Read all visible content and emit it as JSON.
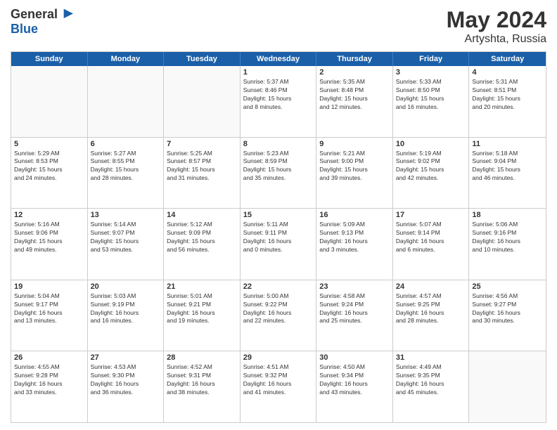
{
  "header": {
    "logo": {
      "general": "General",
      "blue": "Blue",
      "tagline": ""
    },
    "title": "May 2024",
    "subtitle": "Artyshta, Russia"
  },
  "days_of_week": [
    "Sunday",
    "Monday",
    "Tuesday",
    "Wednesday",
    "Thursday",
    "Friday",
    "Saturday"
  ],
  "weeks": [
    [
      {
        "day": "",
        "info": ""
      },
      {
        "day": "",
        "info": ""
      },
      {
        "day": "",
        "info": ""
      },
      {
        "day": "1",
        "info": "Sunrise: 5:37 AM\nSunset: 8:46 PM\nDaylight: 15 hours\nand 8 minutes."
      },
      {
        "day": "2",
        "info": "Sunrise: 5:35 AM\nSunset: 8:48 PM\nDaylight: 15 hours\nand 12 minutes."
      },
      {
        "day": "3",
        "info": "Sunrise: 5:33 AM\nSunset: 8:50 PM\nDaylight: 15 hours\nand 16 minutes."
      },
      {
        "day": "4",
        "info": "Sunrise: 5:31 AM\nSunset: 8:51 PM\nDaylight: 15 hours\nand 20 minutes."
      }
    ],
    [
      {
        "day": "5",
        "info": "Sunrise: 5:29 AM\nSunset: 8:53 PM\nDaylight: 15 hours\nand 24 minutes."
      },
      {
        "day": "6",
        "info": "Sunrise: 5:27 AM\nSunset: 8:55 PM\nDaylight: 15 hours\nand 28 minutes."
      },
      {
        "day": "7",
        "info": "Sunrise: 5:25 AM\nSunset: 8:57 PM\nDaylight: 15 hours\nand 31 minutes."
      },
      {
        "day": "8",
        "info": "Sunrise: 5:23 AM\nSunset: 8:59 PM\nDaylight: 15 hours\nand 35 minutes."
      },
      {
        "day": "9",
        "info": "Sunrise: 5:21 AM\nSunset: 9:00 PM\nDaylight: 15 hours\nand 39 minutes."
      },
      {
        "day": "10",
        "info": "Sunrise: 5:19 AM\nSunset: 9:02 PM\nDaylight: 15 hours\nand 42 minutes."
      },
      {
        "day": "11",
        "info": "Sunrise: 5:18 AM\nSunset: 9:04 PM\nDaylight: 15 hours\nand 46 minutes."
      }
    ],
    [
      {
        "day": "12",
        "info": "Sunrise: 5:16 AM\nSunset: 9:06 PM\nDaylight: 15 hours\nand 49 minutes."
      },
      {
        "day": "13",
        "info": "Sunrise: 5:14 AM\nSunset: 9:07 PM\nDaylight: 15 hours\nand 53 minutes."
      },
      {
        "day": "14",
        "info": "Sunrise: 5:12 AM\nSunset: 9:09 PM\nDaylight: 15 hours\nand 56 minutes."
      },
      {
        "day": "15",
        "info": "Sunrise: 5:11 AM\nSunset: 9:11 PM\nDaylight: 16 hours\nand 0 minutes."
      },
      {
        "day": "16",
        "info": "Sunrise: 5:09 AM\nSunset: 9:13 PM\nDaylight: 16 hours\nand 3 minutes."
      },
      {
        "day": "17",
        "info": "Sunrise: 5:07 AM\nSunset: 9:14 PM\nDaylight: 16 hours\nand 6 minutes."
      },
      {
        "day": "18",
        "info": "Sunrise: 5:06 AM\nSunset: 9:16 PM\nDaylight: 16 hours\nand 10 minutes."
      }
    ],
    [
      {
        "day": "19",
        "info": "Sunrise: 5:04 AM\nSunset: 9:17 PM\nDaylight: 16 hours\nand 13 minutes."
      },
      {
        "day": "20",
        "info": "Sunrise: 5:03 AM\nSunset: 9:19 PM\nDaylight: 16 hours\nand 16 minutes."
      },
      {
        "day": "21",
        "info": "Sunrise: 5:01 AM\nSunset: 9:21 PM\nDaylight: 16 hours\nand 19 minutes."
      },
      {
        "day": "22",
        "info": "Sunrise: 5:00 AM\nSunset: 9:22 PM\nDaylight: 16 hours\nand 22 minutes."
      },
      {
        "day": "23",
        "info": "Sunrise: 4:58 AM\nSunset: 9:24 PM\nDaylight: 16 hours\nand 25 minutes."
      },
      {
        "day": "24",
        "info": "Sunrise: 4:57 AM\nSunset: 9:25 PM\nDaylight: 16 hours\nand 28 minutes."
      },
      {
        "day": "25",
        "info": "Sunrise: 4:56 AM\nSunset: 9:27 PM\nDaylight: 16 hours\nand 30 minutes."
      }
    ],
    [
      {
        "day": "26",
        "info": "Sunrise: 4:55 AM\nSunset: 9:28 PM\nDaylight: 16 hours\nand 33 minutes."
      },
      {
        "day": "27",
        "info": "Sunrise: 4:53 AM\nSunset: 9:30 PM\nDaylight: 16 hours\nand 36 minutes."
      },
      {
        "day": "28",
        "info": "Sunrise: 4:52 AM\nSunset: 9:31 PM\nDaylight: 16 hours\nand 38 minutes."
      },
      {
        "day": "29",
        "info": "Sunrise: 4:51 AM\nSunset: 9:32 PM\nDaylight: 16 hours\nand 41 minutes."
      },
      {
        "day": "30",
        "info": "Sunrise: 4:50 AM\nSunset: 9:34 PM\nDaylight: 16 hours\nand 43 minutes."
      },
      {
        "day": "31",
        "info": "Sunrise: 4:49 AM\nSunset: 9:35 PM\nDaylight: 16 hours\nand 45 minutes."
      },
      {
        "day": "",
        "info": ""
      }
    ]
  ]
}
